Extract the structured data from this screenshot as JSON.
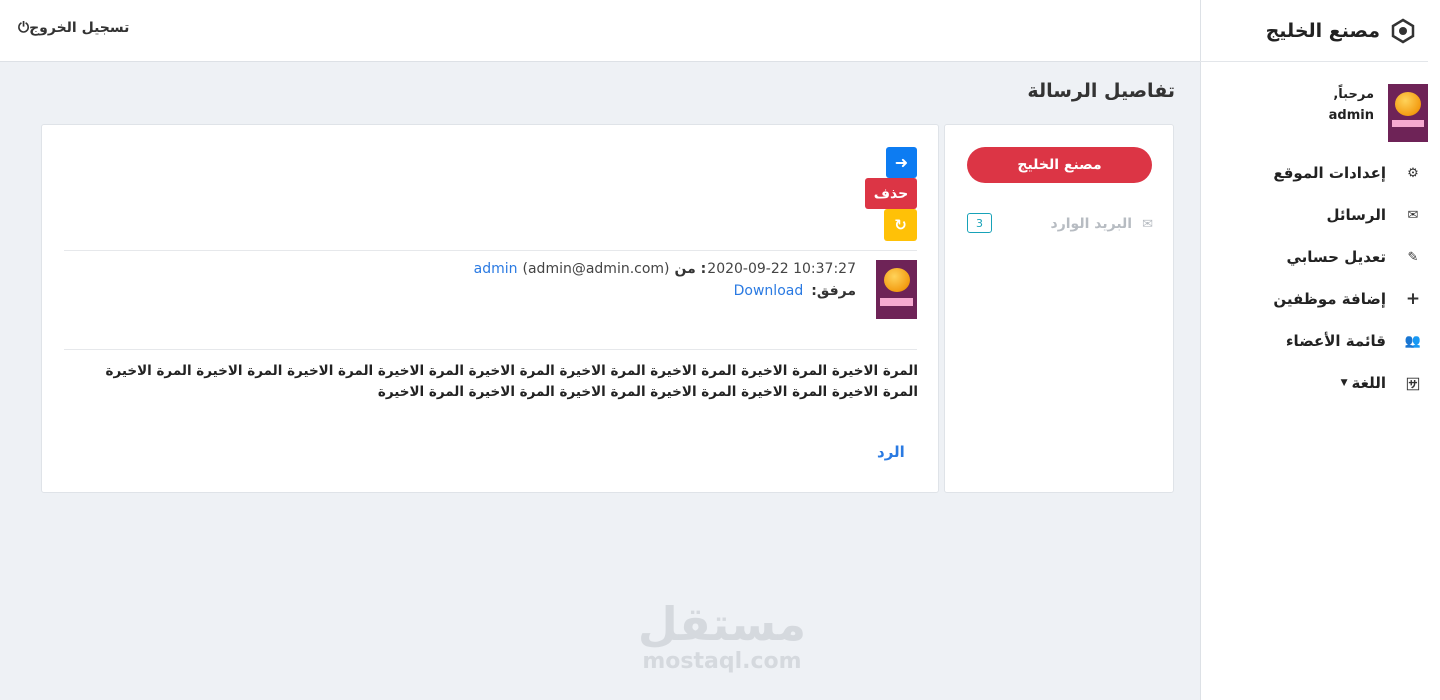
{
  "app": {
    "brand_name": "مصنع الخليج",
    "logout_label": "تسجيل الخروج",
    "page_title": "تفاصيل الرسالة"
  },
  "user": {
    "greeting": "مرحباً,",
    "username": "admin"
  },
  "nav": {
    "items": [
      {
        "label": "إعدادات الموقع",
        "icon": "gear-icon"
      },
      {
        "label": "الرسائل",
        "icon": "envelope-icon"
      },
      {
        "label": "تعديل حسابي",
        "icon": "edit-icon"
      },
      {
        "label": "إضافة موظفين",
        "icon": "plus-icon"
      },
      {
        "label": "قائمة الأعضاء",
        "icon": "users-icon"
      },
      {
        "label": "اللغة",
        "icon": "language-icon"
      }
    ]
  },
  "folders": {
    "compose_label": "مصنع الخليج",
    "inbox_label": "البريد الوارد",
    "inbox_count": "3"
  },
  "message": {
    "delete_label": "حذف",
    "datetime": "2020-09-22 10:37:27",
    "from_label": "من :",
    "sender_email": "(admin@admin.com)",
    "sender_name": "admin",
    "attachment_label": "مرفق:",
    "attachment_link": "Download",
    "body": "المرة الاخيرة  المرة الاخيرة  المرة الاخيرة  المرة الاخيرة  المرة الاخيرة  المرة الاخيرة  المرة الاخيرة  المرة الاخيرة  المرة الاخيرة  المرة الاخيرة  المرة الاخيرة  المرة الاخيرة  المرة الاخيرة  المرة الاخيرة  المرة الاخيرة",
    "reply_label": "الرد"
  },
  "watermark": {
    "arabic": "مستقل",
    "latin": "mostaql.com"
  },
  "colors": {
    "danger": "#dc3545",
    "primary": "#0d7cf2",
    "warning": "#ffc107",
    "link": "#2a7ae2",
    "info": "#17a2b8"
  }
}
